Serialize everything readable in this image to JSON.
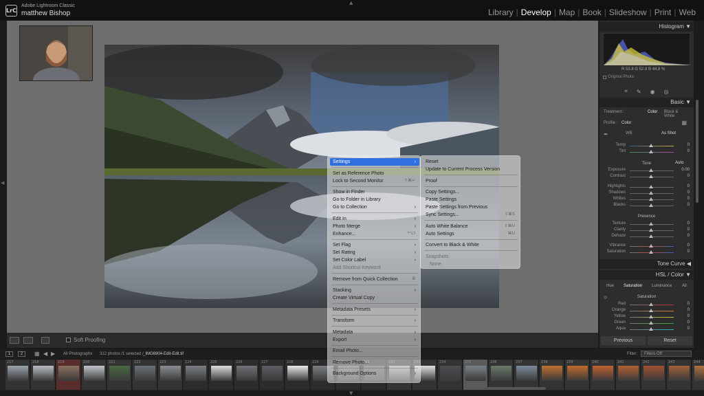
{
  "app": {
    "logo": "LrC",
    "name": "Adobe Lightroom Classic",
    "user": "matthew Bishop"
  },
  "modules": [
    "Library",
    "Develop",
    "Map",
    "Book",
    "Slideshow",
    "Print",
    "Web"
  ],
  "active_module": "Develop",
  "toolbar": {
    "soft_proofing": "Soft Proofing"
  },
  "right_panel": {
    "histogram_title": "Histogram",
    "readout": "R  53.8  G  52.8  B  44.8 %",
    "original_photo": "Original Photo",
    "basic_title": "Basic",
    "treatment_label": "Treatment :",
    "treatment_color": "Color",
    "treatment_bw": "Black & White",
    "profile_label": "Profile :",
    "profile_value": "Color",
    "wb_label": "WB :",
    "wb_value": "As Shot",
    "temp_label": "Temp",
    "temp_value": "0",
    "tint_label": "Tint",
    "tint_value": "0",
    "tone_label": "Tone",
    "auto_label": "Auto",
    "exposure_label": "Exposure",
    "exposure_value": "0.00",
    "contrast_label": "Contrast",
    "contrast_value": "0",
    "highlights_label": "Highlights",
    "highlights_value": "0",
    "shadows_label": "Shadows",
    "shadows_value": "0",
    "whites_label": "Whites",
    "whites_value": "0",
    "blacks_label": "Blacks",
    "blacks_value": "0",
    "presence_label": "Presence",
    "texture_label": "Texture",
    "texture_value": "0",
    "clarity_label": "Clarity",
    "clarity_value": "0",
    "dehaze_label": "Dehaze",
    "dehaze_value": "0",
    "vibrance_label": "Vibrance",
    "vibrance_value": "0",
    "saturation_label": "Saturation",
    "saturation_value": "0",
    "tone_curve_title": "Tone Curve",
    "hsl_title": "HSL / Color",
    "hsl_tabs": [
      "Hue",
      "Saturation",
      "Luminance",
      "All"
    ],
    "hsl_section": "Saturation",
    "red_label": "Red",
    "red_value": "0",
    "orange_label": "Orange",
    "orange_value": "0",
    "yellow_label": "Yellow",
    "yellow_value": "0",
    "green_label": "Green",
    "green_value": "0",
    "aqua_label": "Aqua",
    "aqua_value": "0",
    "previous_btn": "Previous",
    "reset_btn": "Reset"
  },
  "filmbar": {
    "page1": "1",
    "page2": "2",
    "source": "All Photographs",
    "count": "312 photos /1 selected /",
    "filename": "_IMG6904-Edit-Edit.tif",
    "filter_label": "Filter:",
    "filter_value": "Filters Off"
  },
  "filmstrip": {
    "numbers": [
      "217",
      "218",
      "219",
      "220",
      "221",
      "222",
      "223",
      "224",
      "225",
      "226",
      "227",
      "228",
      "229",
      "230",
      "231",
      "232",
      "233",
      "234",
      "235",
      "236",
      "237",
      "238",
      "239",
      "240",
      "241",
      "242",
      "243",
      "244"
    ]
  },
  "context_menu": {
    "items": [
      {
        "label": "Settings",
        "arrow": "›"
      },
      {
        "label": "Set as Reference Photo"
      },
      {
        "label": "Lock to Second Monitor",
        "shortcut": "⇧⌘↩"
      },
      {
        "label": "Show in Finder"
      },
      {
        "label": "Go to Folder in Library"
      },
      {
        "label": "Go to Collection",
        "arrow": "›"
      },
      {
        "label": "Edit In",
        "arrow": "›"
      },
      {
        "label": "Photo Merge",
        "arrow": "›"
      },
      {
        "label": "Enhance...",
        "shortcut": "^⌥I"
      },
      {
        "label": "Set Flag",
        "arrow": "›"
      },
      {
        "label": "Set Rating",
        "arrow": "›"
      },
      {
        "label": "Set Color Label",
        "arrow": "›"
      },
      {
        "label": "Add Shortcut Keyword"
      },
      {
        "label": "Remove from Quick Collection",
        "shortcut": "B"
      },
      {
        "label": "Stacking",
        "arrow": "›"
      },
      {
        "label": "Create Virtual Copy"
      },
      {
        "label": "Metadata Presets",
        "arrow": "›"
      },
      {
        "label": "Transform",
        "arrow": "›"
      },
      {
        "label": "Metadata",
        "arrow": "›"
      },
      {
        "label": "Export",
        "arrow": "›"
      },
      {
        "label": "Email Photo..."
      },
      {
        "label": "Remove Photo..."
      },
      {
        "label": "Background Options",
        "arrow": "›"
      }
    ]
  },
  "settings_submenu": {
    "items": [
      {
        "label": "Reset"
      },
      {
        "label": "Update to Current Process Version"
      },
      {
        "label": "Proof"
      },
      {
        "label": "Copy Settings..."
      },
      {
        "label": "Paste Settings"
      },
      {
        "label": "Paste Settings from Previous"
      },
      {
        "label": "Sync Settings...",
        "shortcut": "⇧⌘S"
      },
      {
        "label": "Auto White Balance",
        "shortcut": "⇧⌘U"
      },
      {
        "label": "Auto Settings",
        "shortcut": "⌘U"
      },
      {
        "label": "Convert to Black & White"
      },
      {
        "label": "Snapshots:"
      },
      {
        "label": "None"
      }
    ]
  },
  "colors": {
    "highlight": "#2f6fe0",
    "work_bg": "#6e6e6e",
    "panel_bg": "#2d2d2d"
  }
}
